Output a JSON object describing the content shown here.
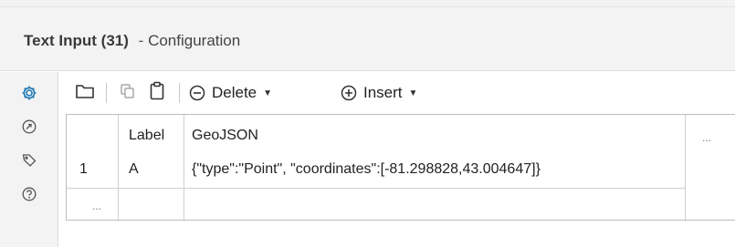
{
  "header": {
    "tool_name": "Text Input (31)",
    "separator": "-",
    "section": "Configuration"
  },
  "sidebar": {
    "items": [
      {
        "icon": "gear-icon",
        "active": true
      },
      {
        "icon": "connection-icon",
        "active": false
      },
      {
        "icon": "tag-icon",
        "active": false
      },
      {
        "icon": "help-icon",
        "active": false
      }
    ]
  },
  "toolbar": {
    "delete_label": "Delete",
    "insert_label": "Insert"
  },
  "table": {
    "columns": [
      "Label",
      "GeoJSON"
    ],
    "header_more": "...",
    "rows": [
      {
        "num": "1",
        "cells": [
          "A",
          "{\"type\":\"Point\", \"coordinates\":[-81.298828,43.004647]}"
        ]
      }
    ],
    "new_row_marker": "..."
  },
  "colors": {
    "accent": "#1f78b4",
    "panel_bg": "#f3f3f3",
    "border": "#bdbdbd"
  }
}
